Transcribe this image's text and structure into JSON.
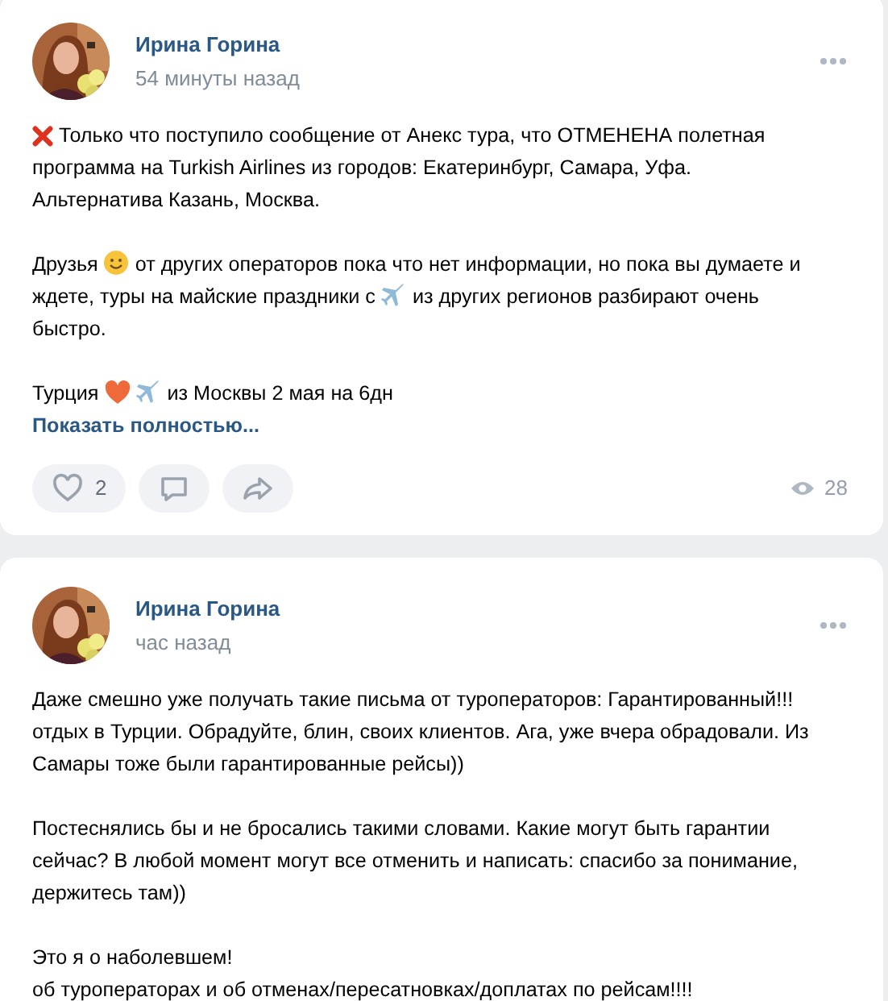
{
  "posts": [
    {
      "author": "Ирина Горина",
      "time": "54 минуты назад",
      "paragraphs": [
        [
          [
            {
              "kind": "cross"
            },
            {
              "kind": "text",
              "text": "Только что поступило сообщение от Анекс тура, что ОТМЕНЕНА полетная"
            }
          ],
          [
            {
              "kind": "text",
              "text": "программа на Turkish Airlines из городов: Екатеринбург, Самара, Уфа."
            }
          ],
          [
            {
              "kind": "text",
              "text": "Альтернатива Казань, Москва."
            }
          ]
        ],
        [
          [
            {
              "kind": "text",
              "text": "Друзья"
            },
            {
              "kind": "smile"
            },
            {
              "kind": "text",
              "text": "от других операторов пока что нет информации, но пока вы думаете и"
            }
          ],
          [
            {
              "kind": "text",
              "text": "ждете, туры на майские праздники с"
            },
            {
              "kind": "plane"
            },
            {
              "kind": "text",
              "text": "из других регионов разбирают очень"
            }
          ],
          [
            {
              "kind": "text",
              "text": "быстро."
            }
          ]
        ],
        [
          [
            {
              "kind": "text",
              "text": "Турция"
            },
            {
              "kind": "heart"
            },
            {
              "kind": "plane"
            },
            {
              "kind": "text",
              "text": "из Москвы 2 мая на 6дн"
            }
          ]
        ]
      ],
      "more_link": "Показать полностью...",
      "actions": {
        "likes": "2",
        "views": "28"
      }
    },
    {
      "author": "Ирина Горина",
      "time": "час назад",
      "paragraphs": [
        [
          [
            {
              "kind": "text",
              "text": "Даже смешно уже получать такие письма от туроператоров: Гарантированный!!!"
            }
          ],
          [
            {
              "kind": "text",
              "text": "отдых в Турции. Обрадуйте, блин, своих клиентов. Ага, уже вчера обрадовали. Из"
            }
          ],
          [
            {
              "kind": "text",
              "text": "Самары тоже были гарантированные рейсы))"
            }
          ]
        ],
        [
          [
            {
              "kind": "text",
              "text": "Постеснялись бы и не бросались такими словами. Какие могут быть гарантии"
            }
          ],
          [
            {
              "kind": "text",
              "text": "сейчас? В любой момент могут все отменить и написать: спасибо за понимание,"
            }
          ],
          [
            {
              "kind": "text",
              "text": "держитесь там))"
            }
          ]
        ],
        [
          [
            {
              "kind": "text",
              "text": "Это я о наболевшем!"
            }
          ],
          [
            {
              "kind": "text",
              "text": "об туроператорах и об отменах/пересатновках/доплатах по рейсам!!!!"
            }
          ]
        ]
      ]
    }
  ]
}
